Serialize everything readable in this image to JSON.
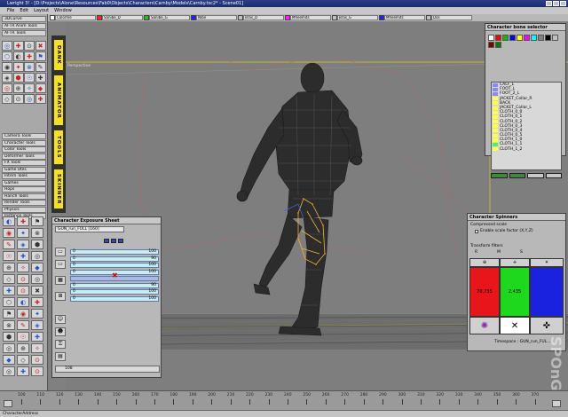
{
  "window": {
    "title": "Lwright 3! - [D:\\Projects\\Alone\\Resources\\Fab0\\Objects\\Characters\\Carnby\\Models\\Carnby.tsc2* - Scene01]"
  },
  "menu": [
    "File",
    "Edit",
    "Layout",
    "Window"
  ],
  "attribute_bar": {
    "fields": [
      {
        "label": "Colorme",
        "color": "#ffffff"
      },
      {
        "label": "Sanibe_D",
        "color": "#ff2020"
      },
      {
        "label": "Sanibe_G",
        "color": "#20c020"
      },
      {
        "label": "Nibe",
        "color": "#2020ff"
      },
      {
        "label": "Bras_D",
        "color": "#c0c0c0"
      },
      {
        "label": "Mheemits",
        "color": "#ff20ff"
      },
      {
        "label": "Bras_G",
        "color": "#c0c0c0"
      },
      {
        "label": "Mheemits",
        "color": "#2020ff"
      },
      {
        "label": "Dos",
        "color": "#c0c0c0"
      }
    ]
  },
  "left_tools": {
    "top_buttons": [
      "3DCurve",
      "AFTR Anim Tools",
      "AFTR Tools"
    ],
    "groups": [
      "Camera Tools",
      "Character Tools",
      "Color Tools",
      "Deformer Tools",
      "FX Tools",
      "Game Utils",
      "Intern Tools",
      "Games",
      "Hops",
      "Hanch Tools",
      "Render Tools",
      "Physics",
      "Instance Tools"
    ]
  },
  "side_tabs": [
    "DANK",
    "ANIMATOR",
    "TOOLS",
    "SKINNER"
  ],
  "viewport": {
    "label": "Perspective"
  },
  "exposure_sheet": {
    "title": "Character Exposure Sheet",
    "clip": "GUN_run_FULL [160]",
    "rows": [
      {
        "frame": "0",
        "value": "100",
        "color": "#c8ecf0"
      },
      {
        "frame": "0",
        "value": "90",
        "color": "#c8ecf0"
      },
      {
        "frame": "0",
        "value": "100",
        "color": "#c8ecf0"
      },
      {
        "frame": "0",
        "value": "100",
        "color": "#c8ecf0"
      },
      {
        "frame": "",
        "value": "",
        "color": "#a8b8e8"
      },
      {
        "frame": "0",
        "value": "90",
        "color": "#c8ecf0"
      },
      {
        "frame": "0",
        "value": "100",
        "color": "#c8ecf0"
      },
      {
        "frame": "0",
        "value": "100",
        "color": "#c8ecf0"
      }
    ],
    "current_frame": "108"
  },
  "bone_selector": {
    "title": "Character bone selector",
    "swatches": [
      "#ffffff",
      "#ff0000",
      "#00c000",
      "#0000ff",
      "#ffff00",
      "#ff00ff",
      "#00ffff",
      "#808080",
      "#000000",
      "#c0c0c0",
      "#800000",
      "#008000"
    ],
    "bones": [
      {
        "name": "CALF_L",
        "color": "#8888ff"
      },
      {
        "name": "FOOT_L",
        "color": "#8888ff"
      },
      {
        "name": "FOOT_2_L",
        "color": "#8888ff"
      },
      {
        "name": "JACKET_Collar_R",
        "color": "#ffff40"
      },
      {
        "name": "BACK",
        "color": "#ffff40"
      },
      {
        "name": "JACKET_Collar_L",
        "color": "#ffff40"
      },
      {
        "name": "CLOTH_0_0",
        "color": "#ffff40"
      },
      {
        "name": "CLOTH_0_1",
        "color": "#ffff40"
      },
      {
        "name": "CLOTH_0_2",
        "color": "#ffff40"
      },
      {
        "name": "CLOTH_0_3",
        "color": "#ffff40"
      },
      {
        "name": "CLOTH_0_4",
        "color": "#ffff40"
      },
      {
        "name": "CLOTH_0_5",
        "color": "#ffff40"
      },
      {
        "name": "CLOTH_1_0",
        "color": "#ffff40"
      },
      {
        "name": "CLOTH_1_1",
        "color": "#40ff40"
      },
      {
        "name": "CLOTH_1_2",
        "color": "#ffff40"
      }
    ]
  },
  "spinners": {
    "title": "Character Spinners",
    "compressed_scale": "Compressed scale",
    "enable_scale": "Enable scale factor (X,Y,Z)",
    "transform_filters": "Transform filters",
    "filter_keys": [
      "R",
      "M",
      "S"
    ],
    "red_value": "70,735",
    "green_value": "2,435",
    "blue_value": "",
    "timespace": "Timespace : GUN_run_FUL..."
  },
  "timeline": {
    "ticks": [
      "100",
      "110",
      "120",
      "130",
      "140",
      "150",
      "160",
      "170",
      "180",
      "190",
      "200",
      "210",
      "220",
      "230",
      "240",
      "250",
      "260",
      "270",
      "280",
      "290",
      "300",
      "310",
      "320",
      "330",
      "340",
      "350",
      "360",
      "370"
    ]
  },
  "status": {
    "text": "CharacterAddress"
  },
  "watermark": {
    "text": "SPOnG"
  }
}
